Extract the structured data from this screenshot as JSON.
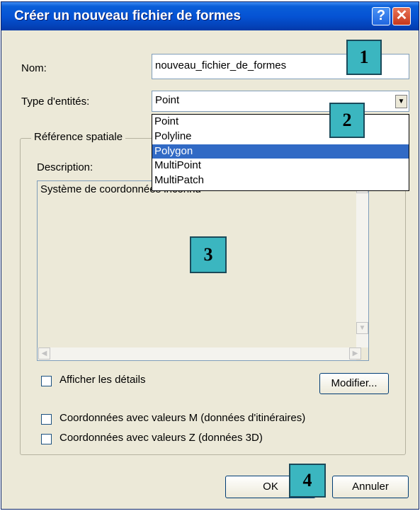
{
  "window": {
    "title": "Créer un nouveau fichier de formes",
    "help_label": "?",
    "close_label": "✕"
  },
  "form": {
    "name_label": "Nom:",
    "name_value": "nouveau_fichier_de_formes",
    "type_label": "Type d'entités:",
    "type_value": "Point",
    "type_options": [
      "Point",
      "Polyline",
      "Polygon",
      "MultiPoint",
      "MultiPatch"
    ],
    "highlighted_option": "Polygon"
  },
  "spatial": {
    "group_label": "Référence spatiale",
    "description_label": "Description:",
    "description_text": "Système de coordonnées inconnu",
    "show_details_label": "Afficher les détails",
    "modify_label": "Modifier..."
  },
  "options": {
    "m_values_label": "Coordonnées avec valeurs M (données d'itinéraires)",
    "z_values_label": "Coordonnées avec valeurs Z (données 3D)"
  },
  "buttons": {
    "ok_label": "OK",
    "cancel_label": "Annuler"
  },
  "callouts": [
    "1",
    "2",
    "3",
    "4"
  ],
  "icons": {
    "dropdown": "chevron-down-icon",
    "scroll_up": "arrow-up-icon",
    "scroll_down": "arrow-down-icon",
    "scroll_left": "arrow-left-icon",
    "scroll_right": "arrow-right-icon"
  },
  "colors": {
    "titlebar": "#0553d4",
    "dialog_bg": "#ece9d8",
    "selection": "#316ac5",
    "callout": "#3bb6c0"
  }
}
